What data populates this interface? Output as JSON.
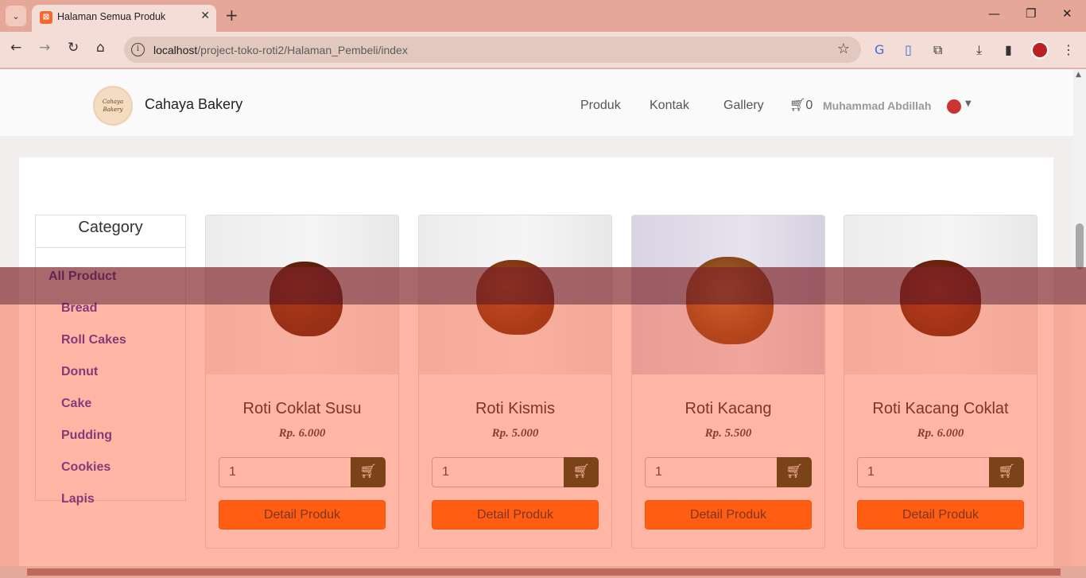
{
  "browser": {
    "tab_title": "Halaman Semua Produk",
    "url_host": "localhost",
    "url_path": "/project-toko-roti2/Halaman_Pembeli/index"
  },
  "header": {
    "brand": "Cahaya Bakery",
    "logo_text": "Cahaya Bakery",
    "nav": [
      "Produk",
      "Kontak",
      "Gallery"
    ],
    "cart_count": "0",
    "user_name": "Muhammad Abdillah"
  },
  "sidebar": {
    "title": "Category",
    "items": [
      "All Product",
      "Bread",
      "Roll Cakes",
      "Donut",
      "Cake",
      "Pudding",
      "Cookies",
      "Lapis"
    ]
  },
  "products": [
    {
      "name": "Roti Coklat Susu",
      "price": "Rp. 6.000",
      "qty": "1",
      "detail_label": "Detail Produk"
    },
    {
      "name": "Roti Kismis",
      "price": "Rp. 5.000",
      "qty": "1",
      "detail_label": "Detail Produk"
    },
    {
      "name": "Roti Kacang",
      "price": "Rp. 5.500",
      "qty": "1",
      "detail_label": "Detail Produk"
    },
    {
      "name": "Roti Kacang Coklat",
      "price": "Rp. 6.000",
      "qty": "1",
      "detail_label": "Detail Produk"
    }
  ],
  "colors": {
    "detail_button": "#ff6600",
    "cart_button": "#1d3b0d",
    "category_link": "#2d2ab0"
  }
}
